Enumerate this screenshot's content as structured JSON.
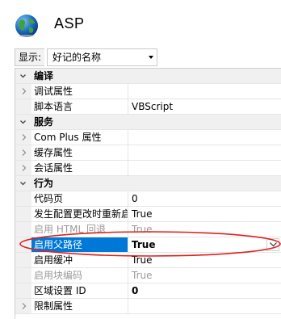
{
  "header": {
    "title": "ASP",
    "icon": "globe-icon"
  },
  "toolbar": {
    "show_label": "显示:",
    "view_value": "好记的名称"
  },
  "accent": "#0078d7",
  "annotation_color": "#e0201f",
  "rows": [
    {
      "kind": "category",
      "name": "编译",
      "expanded": true
    },
    {
      "kind": "item",
      "name": "调试属性",
      "value": "",
      "expandable": true
    },
    {
      "kind": "item",
      "name": "脚本语言",
      "value": "VBScript"
    },
    {
      "kind": "category",
      "name": "服务",
      "expanded": true
    },
    {
      "kind": "item",
      "name": "Com Plus 属性",
      "value": "",
      "expandable": true
    },
    {
      "kind": "item",
      "name": "缓存属性",
      "value": "",
      "expandable": true
    },
    {
      "kind": "item",
      "name": "会话属性",
      "value": "",
      "expandable": true
    },
    {
      "kind": "category",
      "name": "行为",
      "expanded": true
    },
    {
      "kind": "item",
      "name": "代码页",
      "value": "0"
    },
    {
      "kind": "item",
      "name": "发生配置更改时重新启",
      "value": "True"
    },
    {
      "kind": "item",
      "name": "启用 HTML 回退",
      "value": "True",
      "disabled": true
    },
    {
      "kind": "item",
      "name": "启用父路径",
      "value": "True",
      "selected": true
    },
    {
      "kind": "item",
      "name": "启用缓冲",
      "value": "True"
    },
    {
      "kind": "item",
      "name": "启用块编码",
      "value": "True",
      "disabled": true
    },
    {
      "kind": "item",
      "name": "区域设置 ID",
      "value": "0",
      "bold_value": true
    },
    {
      "kind": "item",
      "name": "限制属性",
      "value": "",
      "expandable": true
    }
  ]
}
